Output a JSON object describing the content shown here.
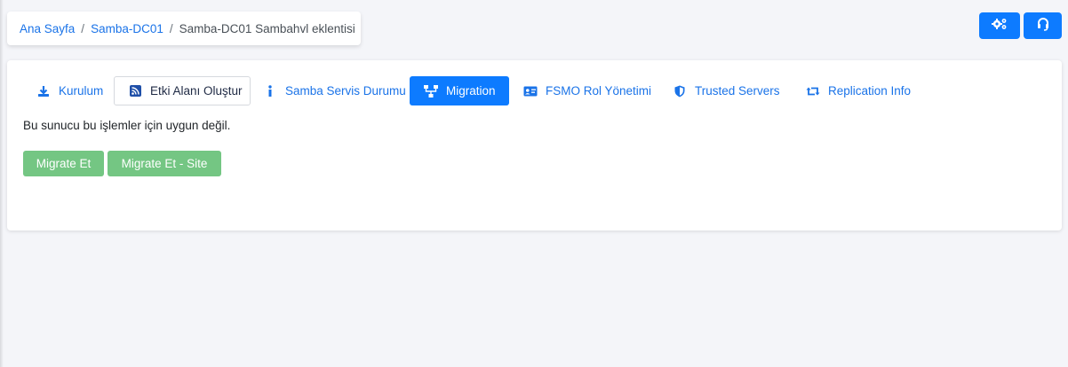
{
  "breadcrumb": {
    "home": "Ana Sayfa",
    "server": "Samba-DC01",
    "current": "Samba-DC01 Sambahvl eklentisi",
    "separator": "/"
  },
  "header_buttons": {
    "settings_icon": "gears-icon",
    "support_icon": "headset-icon"
  },
  "tabs": [
    {
      "label": "Kurulum",
      "icon": "download-icon"
    },
    {
      "label": "Etki Alanı Oluştur",
      "icon": "rss-icon"
    },
    {
      "label": "Samba Servis Durumu",
      "icon": "info-icon"
    },
    {
      "label": "Migration",
      "icon": "sitemap-icon",
      "active": true
    },
    {
      "label": "FSMO Rol Yönetimi",
      "icon": "id-card-icon"
    },
    {
      "label": "Trusted Servers",
      "icon": "shield-icon"
    },
    {
      "label": "Replication Info",
      "icon": "retweet-icon"
    }
  ],
  "content": {
    "message": "Bu sunucu bu işlemler için uygun değil.",
    "buttons": {
      "migrate": "Migrate Et",
      "migrate_site": "Migrate Et - Site"
    }
  },
  "colors": {
    "primary": "#0d7bff",
    "link": "#1a73e8",
    "success_disabled": "#74c683",
    "background": "#f4f5f9"
  }
}
